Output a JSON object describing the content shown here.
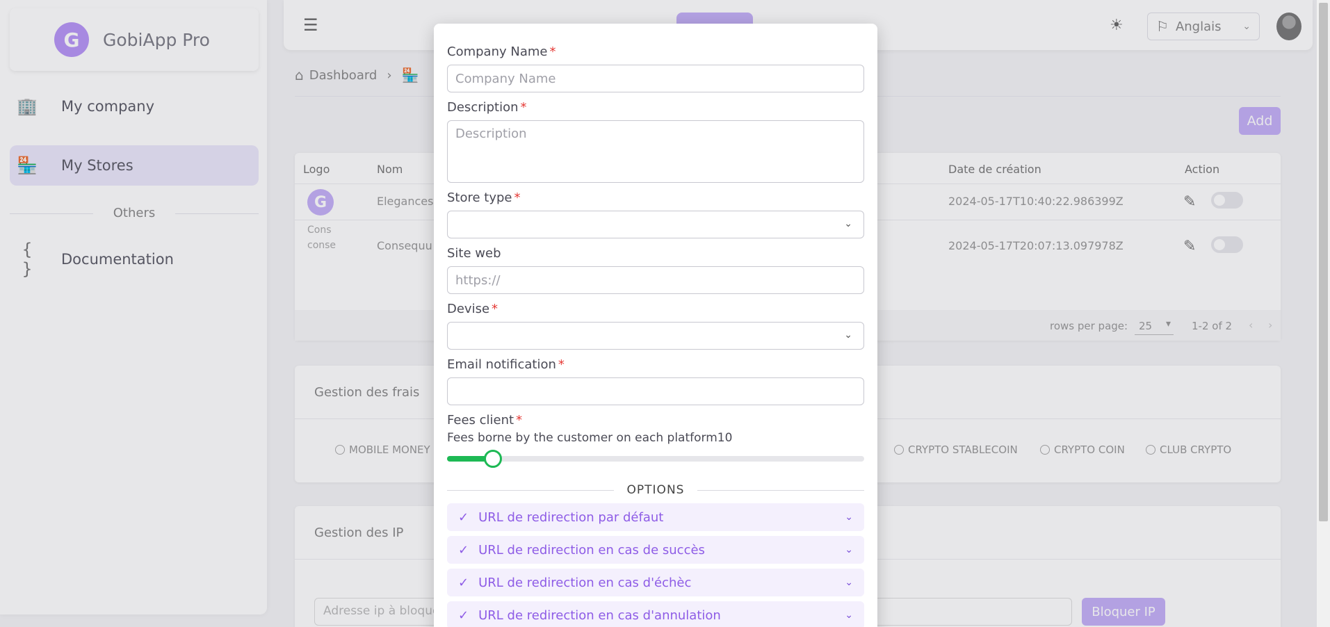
{
  "sidebar": {
    "brand_logo": "G",
    "brand_name": "GobiApp Pro",
    "items": [
      {
        "label": "My company",
        "icon": "building-icon"
      },
      {
        "label": "My Stores",
        "icon": "store-icon"
      }
    ],
    "section": "Others",
    "doc_item": {
      "label": "Documentation",
      "icon": "braces-icon"
    }
  },
  "topbar": {
    "language": "Anglais"
  },
  "breadcrumb": {
    "home": "Dashboard"
  },
  "page": {
    "add_label": "Add"
  },
  "table": {
    "headers": {
      "logo": "Logo",
      "name": "Nom",
      "created": "Date de création",
      "action": "Action"
    },
    "rows": [
      {
        "logo": "G",
        "name": "Elegances",
        "created": "2024-05-17T10:40:22.986399Z"
      },
      {
        "logo_alt": "Cons\nconse",
        "name": "Consequu",
        "created": "2024-05-17T20:07:13.097978Z"
      }
    ],
    "rows_per_page_label": "rows per page:",
    "rows_per_page": "25",
    "pagination": "1-2 of 2"
  },
  "fees_card": {
    "title": "Gestion des frais",
    "methods": [
      "MOBILE MONEY",
      "CRYPTO STABLECOIN",
      "CRYPTO COIN",
      "CLUB CRYPTO"
    ]
  },
  "ip_card": {
    "title": "Gestion des IP",
    "input_placeholder": "Adresse ip  à bloquer",
    "block_label": "Bloquer IP"
  },
  "modal": {
    "company_name": {
      "label": "Company Name",
      "placeholder": "Company Name",
      "value": ""
    },
    "description": {
      "label": "Description",
      "placeholder": "Description",
      "value": ""
    },
    "store_type": {
      "label": "Store type",
      "value": ""
    },
    "site_web": {
      "label": "Site web",
      "placeholder": "https://",
      "value": ""
    },
    "devise": {
      "label": "Devise",
      "value": ""
    },
    "email_notification": {
      "label": "Email notification",
      "value": ""
    },
    "fees_client": {
      "label": "Fees client",
      "help": "Fees borne by the customer on each platform10",
      "value": 10,
      "max": 100
    },
    "options_title": "OPTIONS",
    "options": [
      "URL de redirection par défaut",
      "URL de redirection en cas de succès",
      "URL de redirection en cas d'échèc",
      "URL de redirection en cas d'annulation"
    ]
  },
  "colors": {
    "accent": "#8e5ce6",
    "accent_light": "#c4b0f7",
    "slider": "#1db954",
    "required": "#e53935"
  }
}
